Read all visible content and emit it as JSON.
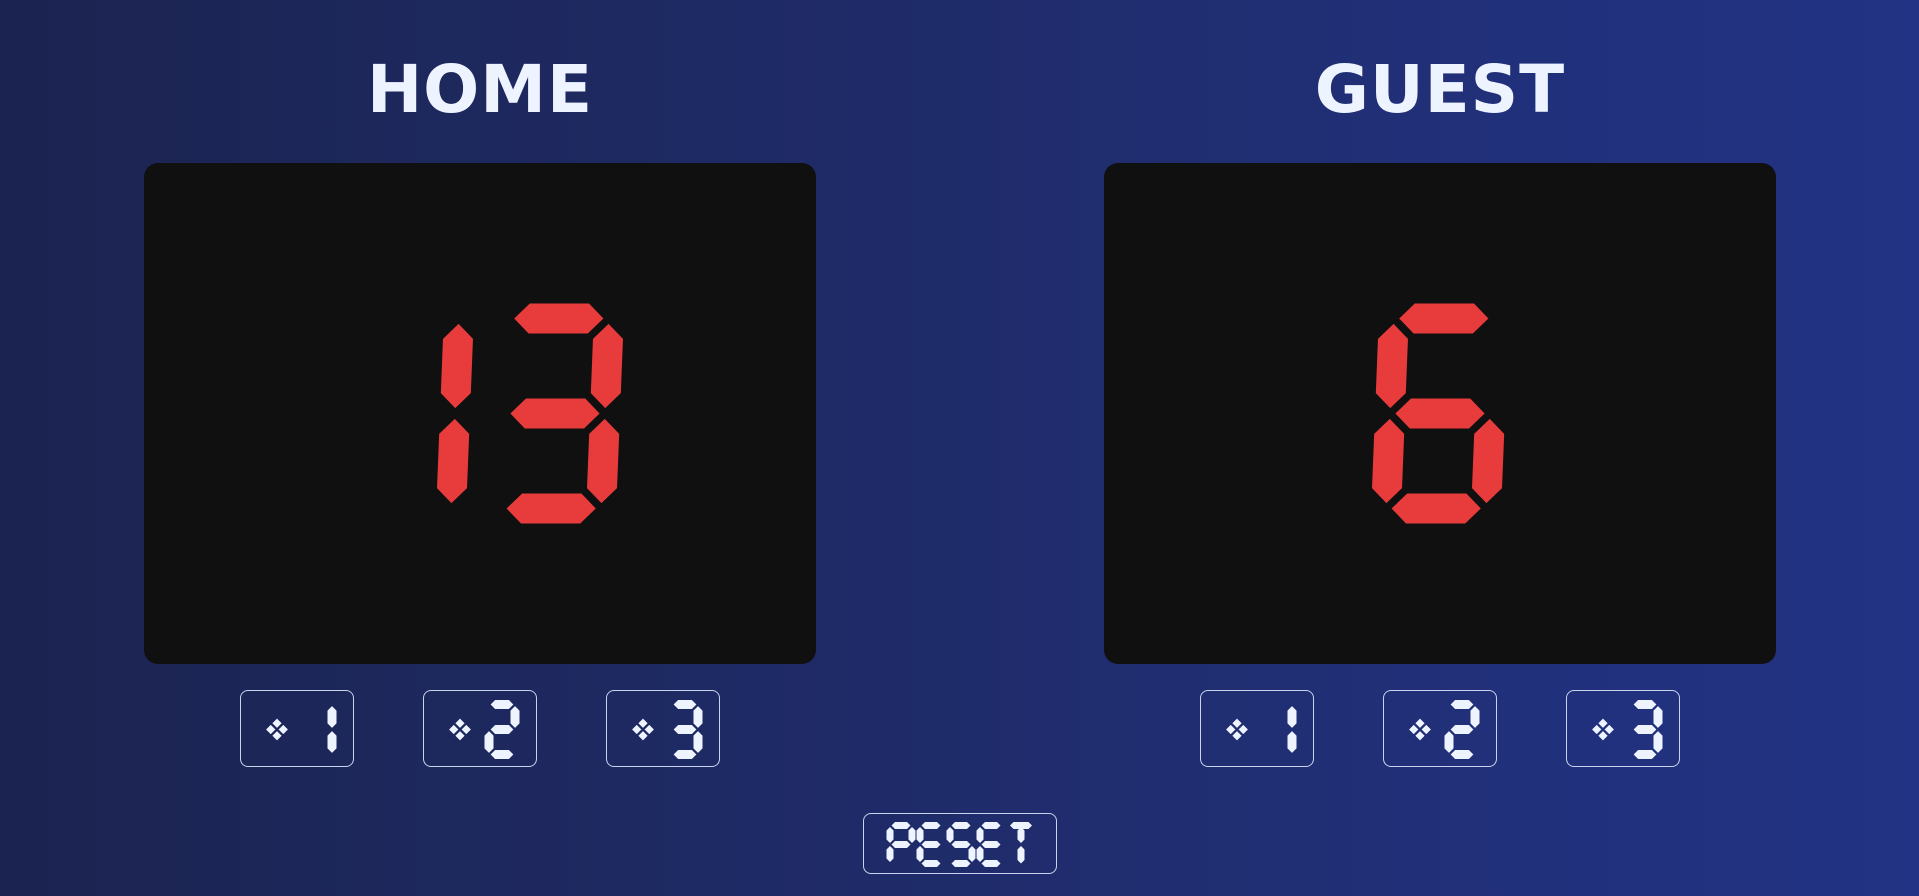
{
  "home": {
    "title": "HOME",
    "score": "13",
    "buttons": [
      {
        "label": "+1",
        "points": 1
      },
      {
        "label": "+2",
        "points": 2
      },
      {
        "label": "+3",
        "points": 3
      }
    ]
  },
  "guest": {
    "title": "GUEST",
    "score": "6",
    "buttons": [
      {
        "label": "+1",
        "points": 1
      },
      {
        "label": "+2",
        "points": 2
      },
      {
        "label": "+3",
        "points": 3
      }
    ]
  },
  "reset": {
    "label": "RESET"
  },
  "colors": {
    "score_segment": "#e83c3c",
    "button_segment": "#eef4ff",
    "panel": "#101010",
    "title": "#eef4ff"
  }
}
